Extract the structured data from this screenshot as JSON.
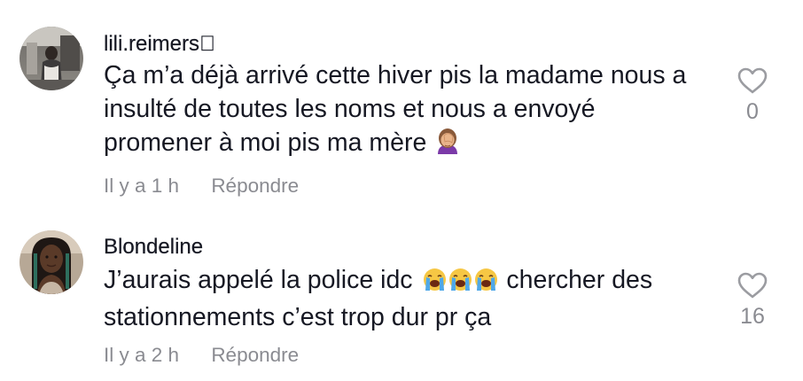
{
  "comments": [
    {
      "username": "lili.reimers⃝",
      "line1": "Ça m’a déjà arrivé cette hiver pis la madame nous a",
      "line2": "insulté de toutes les noms et nous a envoyé",
      "line3": "promener à moi pis ma mère",
      "emoji": "woman-facepalming-emoji",
      "time": "Il y a 1 h",
      "reply_label": "Répondre",
      "like_count": "0",
      "like_icon": "heart-outline-icon"
    },
    {
      "username": "Blondeline",
      "line1_start": "J’aurais appelé la police idc",
      "line1_end": "chercher des",
      "line2": "stationnements c’est trop dur pr ça",
      "emoji": "loudly-crying-face-emoji",
      "emoji_count": 3,
      "time": "Il y a 2 h",
      "reply_label": "Répondre",
      "like_count": "16",
      "like_icon": "heart-outline-icon"
    }
  ],
  "colors": {
    "text": "#161823",
    "secondary": "#8a8b91",
    "heart_stroke": "#9b9ca1"
  }
}
